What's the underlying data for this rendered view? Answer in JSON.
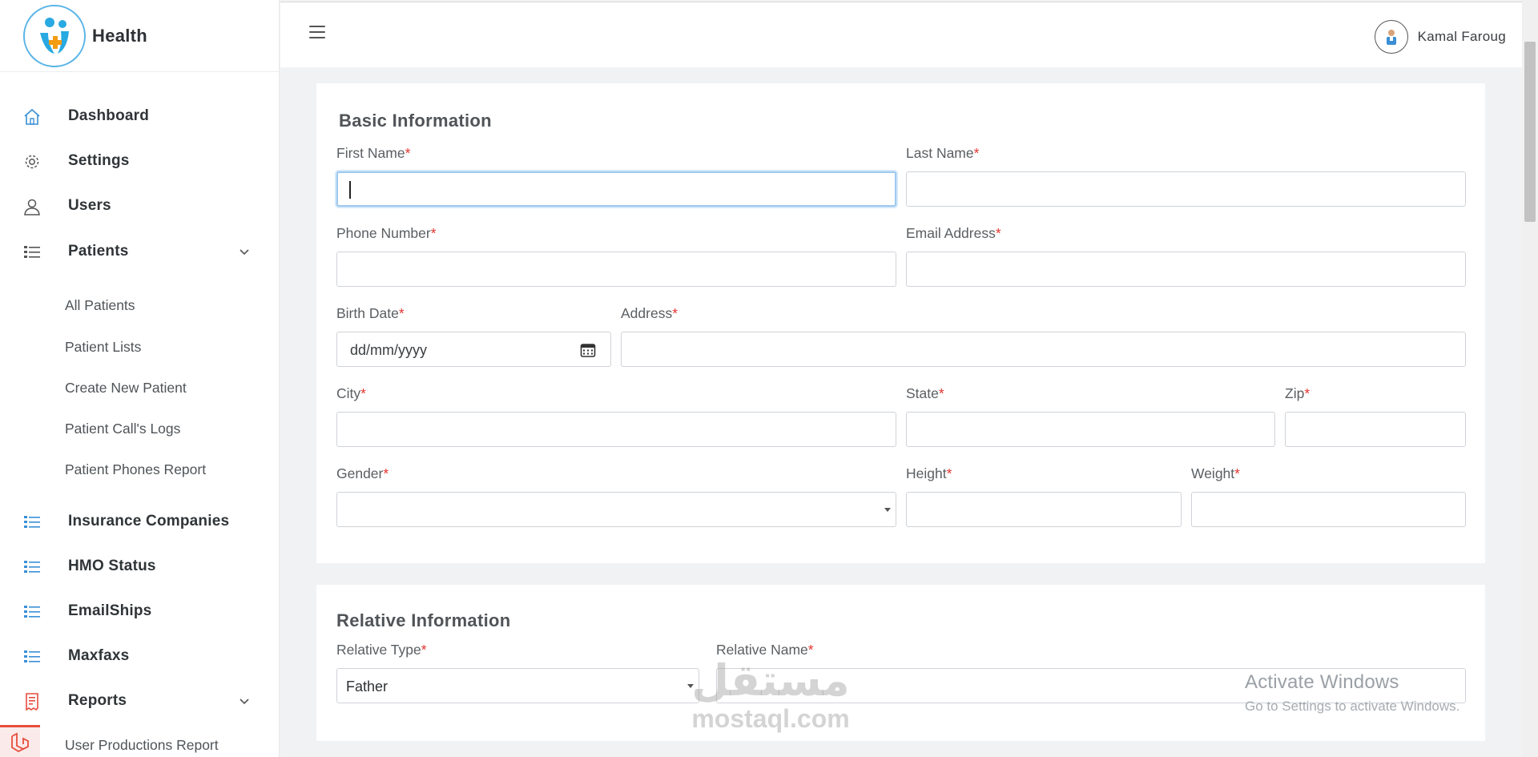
{
  "brand": {
    "name": "Health"
  },
  "topbar": {
    "user_name": "Kamal Faroug"
  },
  "sidebar": {
    "items": [
      {
        "label": "Dashboard",
        "icon": "home-icon"
      },
      {
        "label": "Settings",
        "icon": "gear-icon"
      },
      {
        "label": "Users",
        "icon": "user-icon"
      },
      {
        "label": "Patients",
        "icon": "list-icon",
        "expanded": true
      },
      {
        "label": "Insurance Companies",
        "icon": "list-icon"
      },
      {
        "label": "HMO Status",
        "icon": "list-icon"
      },
      {
        "label": "EmailShips",
        "icon": "list-icon"
      },
      {
        "label": "Maxfaxs",
        "icon": "list-icon"
      },
      {
        "label": "Reports",
        "icon": "receipt-icon",
        "expanded": true
      }
    ],
    "patients_sub": [
      "All Patients",
      "Patient Lists",
      "Create New Patient",
      "Patient Call's Logs",
      "Patient Phones Report"
    ],
    "reports_sub": [
      "User Productions Report"
    ]
  },
  "basic": {
    "title": "Basic Information",
    "required_mark": "*",
    "first_name": "First Name",
    "last_name": "Last Name",
    "phone": "Phone Number",
    "email": "Email Address",
    "birth_date": "Birth Date",
    "birth_placeholder": "dd/mm/yyyy",
    "address": "Address",
    "city": "City",
    "state": "State",
    "zip": "Zip",
    "gender": "Gender",
    "height": "Height",
    "weight": "Weight"
  },
  "relative": {
    "title": "Relative Information",
    "type_label": "Relative Type",
    "type_value": "Father",
    "name_label": "Relative Name"
  },
  "watermarks": {
    "activate_title": "Activate Windows",
    "activate_sub": "Go to Settings to activate Windows.",
    "mostaql_ar": "مستقل",
    "mostaql_en": "mostaql.com"
  },
  "colors": {
    "accent": "#3a8fd6",
    "required": "#e3342f",
    "reports_icon": "#e74c3c"
  }
}
